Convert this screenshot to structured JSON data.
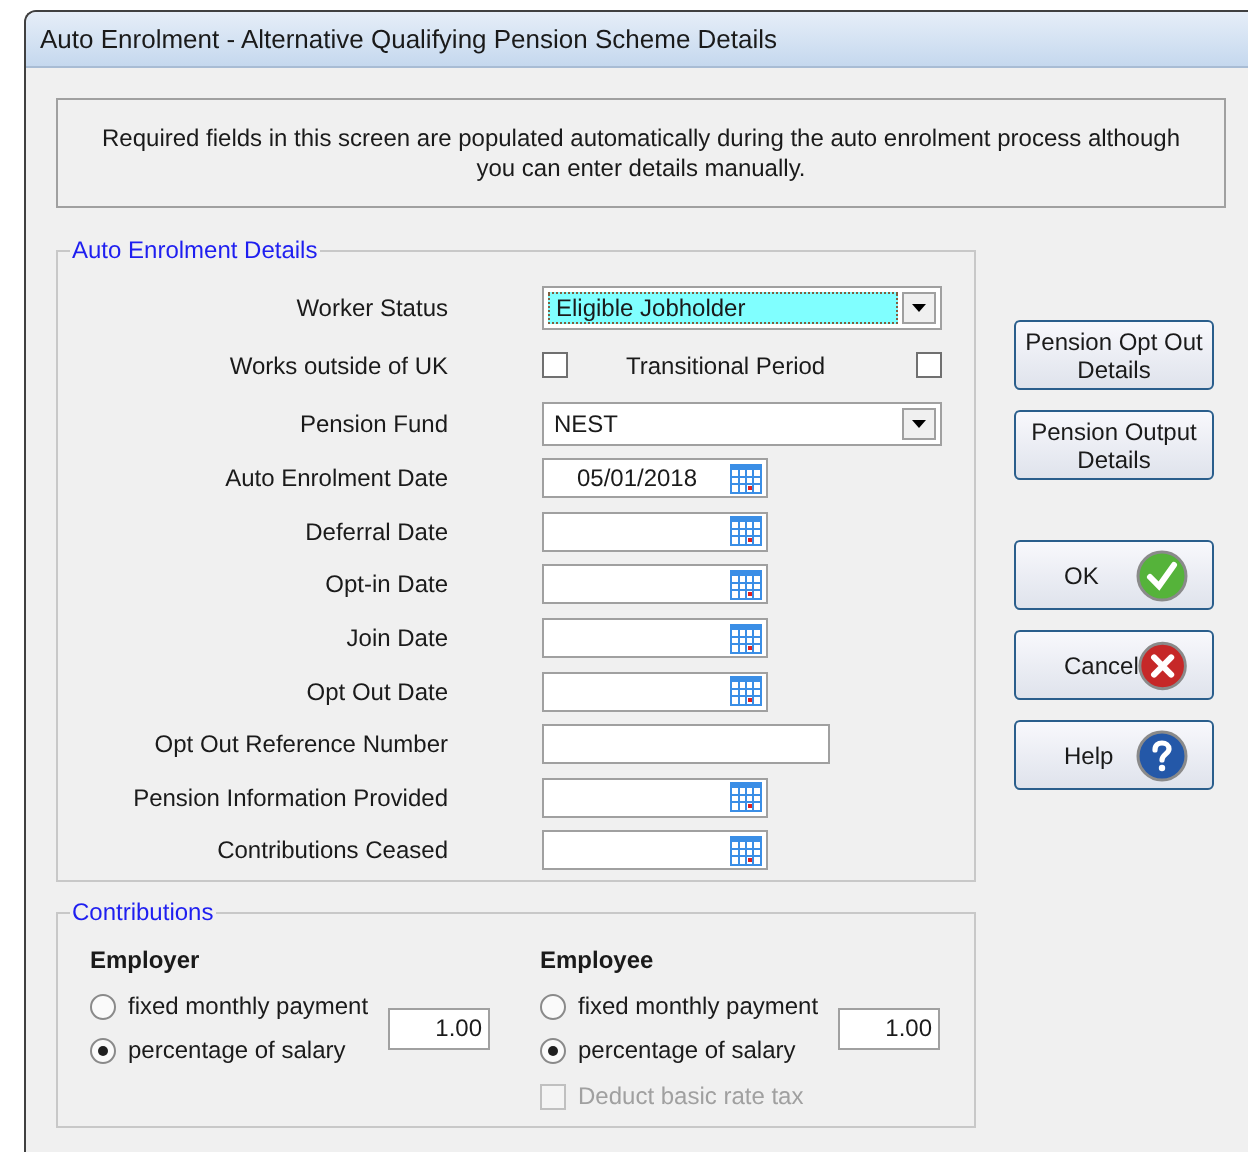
{
  "window": {
    "title": "Auto Enrolment - Alternative Qualifying Pension Scheme Details"
  },
  "notice": "Required fields in this screen are populated automatically during the auto enrolment process although you can enter details manually.",
  "details": {
    "legend": "Auto Enrolment Details",
    "fields": [
      {
        "kind": "combo",
        "label": "Worker Status",
        "value": "Eligible Jobholder",
        "highlighted": true
      },
      {
        "kind": "checks",
        "label": "Works outside of UK",
        "checked": false,
        "second_label": "Transitional Period",
        "second_checked": false
      },
      {
        "kind": "combo",
        "label": "Pension Fund",
        "value": "NEST",
        "highlighted": false
      },
      {
        "kind": "date",
        "label": "Auto Enrolment Date",
        "value": "05/01/2018"
      },
      {
        "kind": "date",
        "label": "Deferral Date"
      },
      {
        "kind": "date",
        "label": "Opt-in Date"
      },
      {
        "kind": "date",
        "label": "Join Date"
      },
      {
        "kind": "date",
        "label": "Opt Out Date"
      },
      {
        "kind": "text",
        "label": "Opt Out Reference Number"
      },
      {
        "kind": "date",
        "label": "Pension Information Provided"
      },
      {
        "kind": "date",
        "label": "Contributions Ceased"
      }
    ]
  },
  "side_buttons": [
    {
      "kind": "plain",
      "label": "Pension Opt Out Details"
    },
    {
      "kind": "plain",
      "label": "Pension Output Details"
    },
    {
      "kind": "ok",
      "label": "OK"
    },
    {
      "kind": "cancel",
      "label": "Cancel"
    },
    {
      "kind": "help",
      "label": "Help"
    }
  ],
  "contributions": {
    "legend": "Contributions",
    "groups": [
      {
        "heading": "Employer",
        "options": [
          {
            "label": "fixed monthly payment",
            "selected": false
          },
          {
            "label": "percentage of salary",
            "selected": true
          }
        ],
        "amount": "1.00"
      },
      {
        "heading": "Employee",
        "options": [
          {
            "label": "fixed monthly payment",
            "selected": false
          },
          {
            "label": "percentage of salary",
            "selected": true
          }
        ],
        "amount": "1.00",
        "extra": {
          "label": "Deduct basic rate tax",
          "checked": false,
          "disabled": true
        }
      }
    ]
  }
}
